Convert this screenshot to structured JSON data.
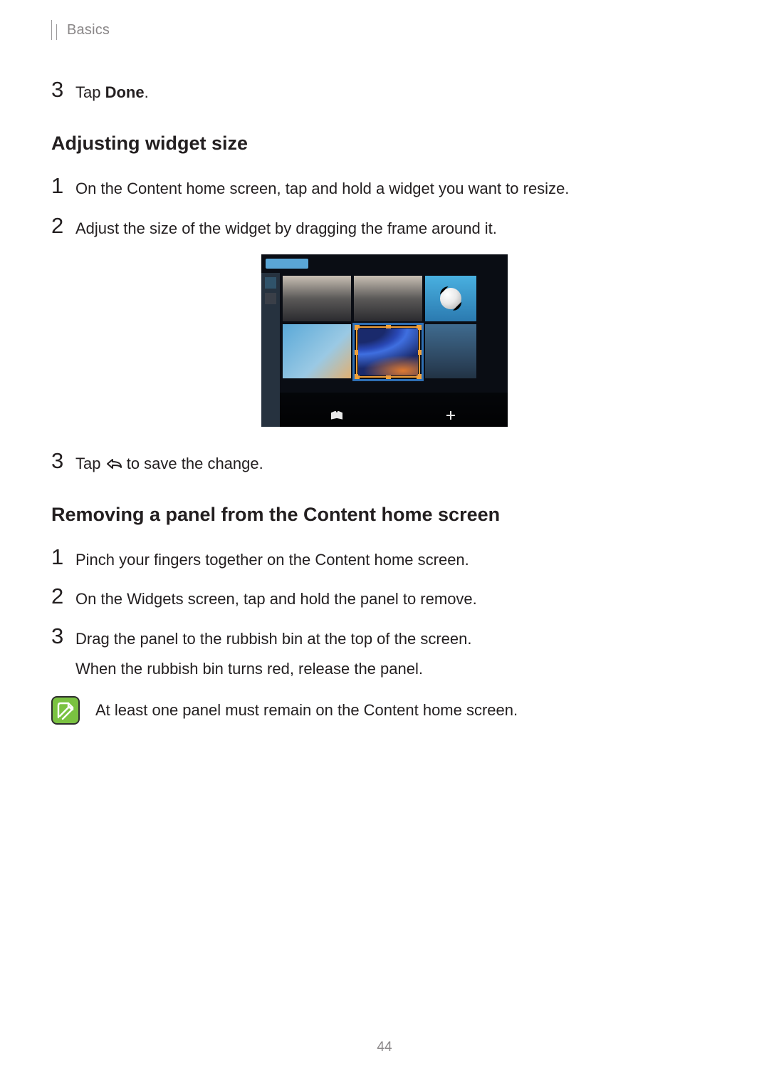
{
  "breadcrumb": "Basics",
  "step_top": {
    "num": "3",
    "prefix": "Tap ",
    "bold": "Done",
    "suffix": "."
  },
  "section1": {
    "heading": "Adjusting widget size",
    "steps": [
      {
        "num": "1",
        "text": "On the Content home screen, tap and hold a widget you want to resize."
      },
      {
        "num": "2",
        "text": "Adjust the size of the widget by dragging the frame around it."
      }
    ],
    "step3": {
      "num": "3",
      "before": "Tap ",
      "after": " to save the change."
    }
  },
  "illustration": {
    "softkeys": [
      {
        "name": "magazine",
        "label": ""
      },
      {
        "name": "change-size",
        "label": ""
      }
    ]
  },
  "section2": {
    "heading": "Removing a panel from the Content home screen",
    "steps": [
      {
        "num": "1",
        "text": "Pinch your fingers together on the Content home screen."
      },
      {
        "num": "2",
        "text": "On the Widgets screen, tap and hold the panel to remove."
      },
      {
        "num": "3",
        "text": "Drag the panel to the rubbish bin at the top of the screen.",
        "text2": "When the rubbish bin turns red, release the panel."
      }
    ]
  },
  "note": "At least one panel must remain on the Content home screen.",
  "page_number": "44"
}
